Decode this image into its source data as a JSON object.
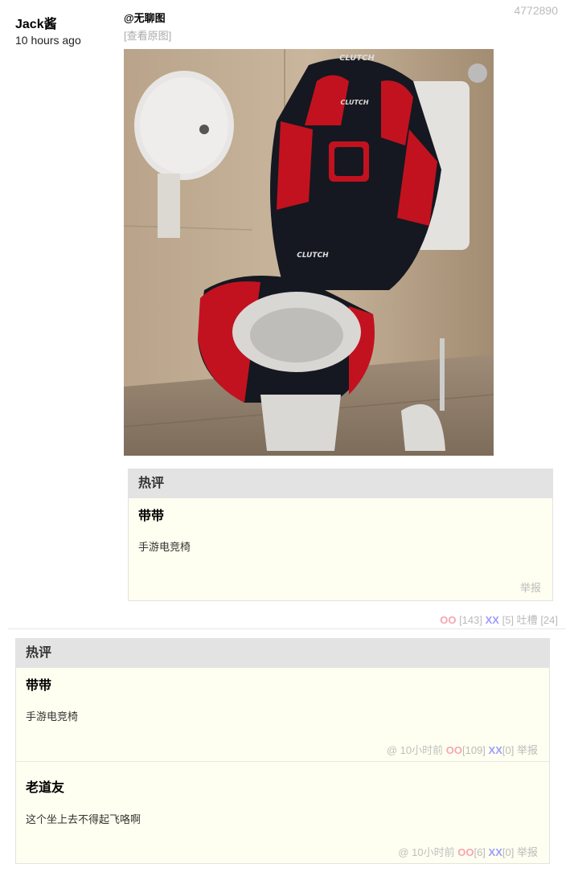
{
  "post": {
    "id": "4772890",
    "author": "Jack酱",
    "time": "10 hours ago",
    "tag": "@无聊图",
    "view_original": "[查看原图]",
    "votes": {
      "oo_label": "OO",
      "oo_count": "[143]",
      "xx_label": "XX",
      "xx_count": "[5]",
      "tucao_label": "吐槽",
      "tucao_count": "[24]"
    }
  },
  "inline_hot": {
    "header": "热评",
    "name": "带带",
    "text": "手游电竞椅",
    "report": "举报"
  },
  "hot_comments": {
    "header": "热评",
    "items": [
      {
        "name": "带带",
        "text": "手游电竞椅",
        "at": "@",
        "time": "10小时前",
        "oo_label": "OO",
        "oo": "[109]",
        "xx_label": "XX",
        "xx": "[0]",
        "report": "举报"
      },
      {
        "name": "老道友",
        "text": "这个坐上去不得起飞咯啊",
        "at": "@",
        "time": "10小时前",
        "oo_label": "OO",
        "oo": "[6]",
        "xx_label": "XX",
        "xx": "[0]",
        "report": "举报"
      }
    ]
  },
  "colors": {
    "oo": "#f8a5b0",
    "xx": "#9d9dff",
    "panel_bg": "#fefff0",
    "header_bg": "#e3e3e3"
  },
  "photo": {
    "chair_brand": "CLUTCH"
  }
}
